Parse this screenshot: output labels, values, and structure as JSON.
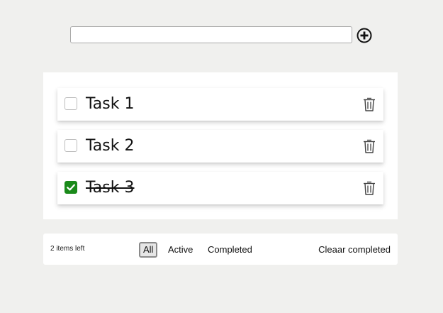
{
  "new_task": {
    "value": "",
    "placeholder": ""
  },
  "add_button": {
    "icon": "plus-circle-icon"
  },
  "tasks": [
    {
      "label": "Task 1",
      "completed": false
    },
    {
      "label": "Task 2",
      "completed": false
    },
    {
      "label": "Task 3",
      "completed": true
    }
  ],
  "footer": {
    "items_left": "2 items left",
    "filters": [
      {
        "label": "All",
        "selected": true
      },
      {
        "label": "Active",
        "selected": false
      },
      {
        "label": "Completed",
        "selected": false
      }
    ],
    "clear_label": "Cleaar completed"
  },
  "colors": {
    "background": "#f0f0ee",
    "panel": "#ffffff",
    "checked": "#1a8a1a",
    "selected_filter_border": "#8a8a8a"
  }
}
